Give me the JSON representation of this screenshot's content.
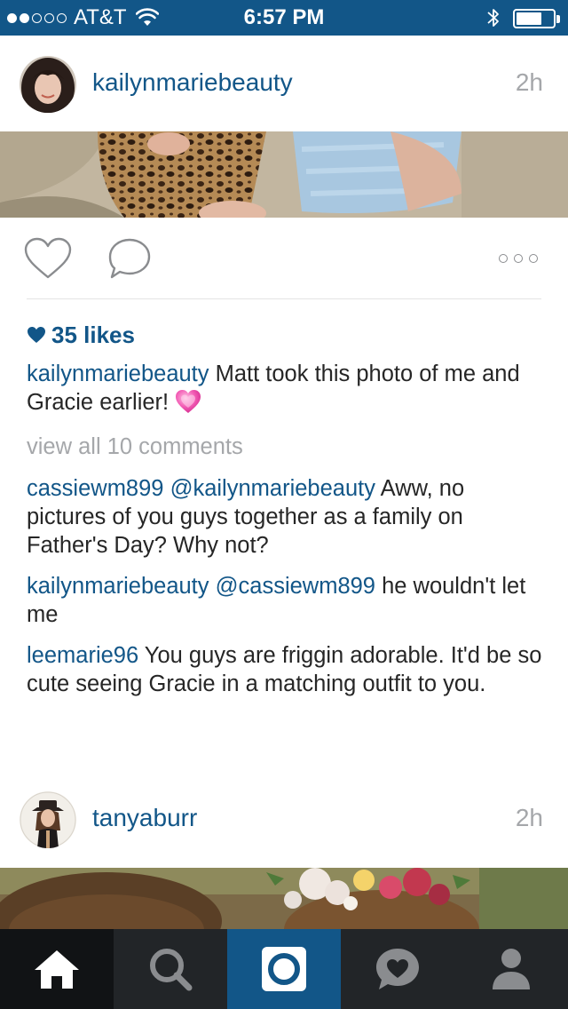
{
  "status_bar": {
    "carrier": "AT&T",
    "time": "6:57 PM",
    "signal_bars_filled": 2,
    "signal_bars_total": 5
  },
  "posts": [
    {
      "username": "kailynmariebeauty",
      "time_ago": "2h",
      "likes": "35 likes",
      "caption": {
        "username": "kailynmariebeauty",
        "text": " Matt took this photo of me and Gracie earlier!"
      },
      "view_all_comments": "view all 10 comments",
      "comments": [
        {
          "username": "cassiewm899",
          "mention": "@kailynmariebeauty",
          "text": " Aww, no pictures of you guys together as a family on Father's Day? Why not?"
        },
        {
          "username": "kailynmariebeauty",
          "mention": "@cassiewm899",
          "text": " he wouldn't let me"
        },
        {
          "username": "leemarie96",
          "mention": "",
          "text": " You guys are friggin adorable. It'd be so cute seeing Gracie in a matching outfit to you."
        }
      ]
    },
    {
      "username": "tanyaburr",
      "time_ago": "2h"
    }
  ],
  "icons": {
    "like": "heart-outline-icon",
    "comment": "comment-bubble-icon",
    "more": "more-options-icon",
    "likes_heart": "heart-filled-icon",
    "caption_emoji": "sparkling-heart-emoji"
  },
  "tabs": [
    {
      "name": "home",
      "icon": "home-icon",
      "active": true
    },
    {
      "name": "explore",
      "icon": "search-icon",
      "active": false
    },
    {
      "name": "camera",
      "icon": "camera-icon",
      "active": false
    },
    {
      "name": "activity",
      "icon": "activity-heart-icon",
      "active": false
    },
    {
      "name": "profile",
      "icon": "profile-icon",
      "active": false
    }
  ],
  "colors": {
    "brand_blue": "#125688",
    "link_blue": "#125688",
    "muted_gray": "#a5a7aa",
    "tab_bar": "#222528"
  }
}
